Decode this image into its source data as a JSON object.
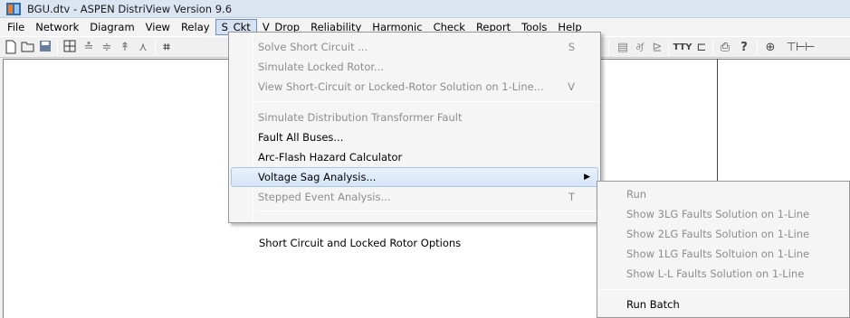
{
  "title": "BGU.dtv - ASPEN DistriView Version 9.6",
  "menubar": [
    "File",
    "Network",
    "Diagram",
    "View",
    "Relay",
    "S_Ckt",
    "V_Drop",
    "Reliability",
    "Harmonic",
    "Check",
    "Report",
    "Tools",
    "Help"
  ],
  "active_menu": "S_Ckt",
  "sckt_menu": {
    "solve": {
      "label": "Solve Short Circuit ...",
      "shortcut": "S"
    },
    "locked_rotor": {
      "label": "Simulate Locked Rotor..."
    },
    "view_solution": {
      "label": "View Short-Circuit or Locked-Rotor Solution on 1-Line...",
      "shortcut": "V"
    },
    "dist_xfmr": {
      "label": "Simulate Distribution Transformer Fault"
    },
    "fault_all": {
      "label": "Fault All Buses..."
    },
    "arc_flash": {
      "label": "Arc-Flash Hazard Calculator"
    },
    "voltage_sag": {
      "label": "Voltage Sag Analysis..."
    },
    "stepped": {
      "label": "Stepped Event Analysis...",
      "shortcut": "T"
    },
    "options": {
      "label": "Short Circuit and Locked Rotor Options"
    }
  },
  "sag_submenu": {
    "run": "Run",
    "show_3lg": "Show 3LG Faults Solution on 1-Line",
    "show_2lg": "Show 2LG Faults Solution on 1-Line",
    "show_1lg": "Show 1LG Faults Soltuion on 1-Line",
    "show_ll": "Show L-L Faults Solution on 1-Line",
    "run_batch": "Run Batch"
  },
  "toolbar_icons": [
    "new-file-icon",
    "open-folder-icon",
    "save-icon",
    "grid-icon",
    "bus-tool-icon",
    "line-tool-icon",
    "xfmr-tool-icon",
    "load-tool-icon",
    "breaker-tool-icon",
    "report-icon",
    "edit-icon",
    "chart-icon",
    "tty-icon",
    "plot-icon",
    "print-icon",
    "help-icon",
    "zoom-in-icon",
    "scale-icon"
  ],
  "toolbar_glyphs": {
    "tty": "TTY"
  }
}
